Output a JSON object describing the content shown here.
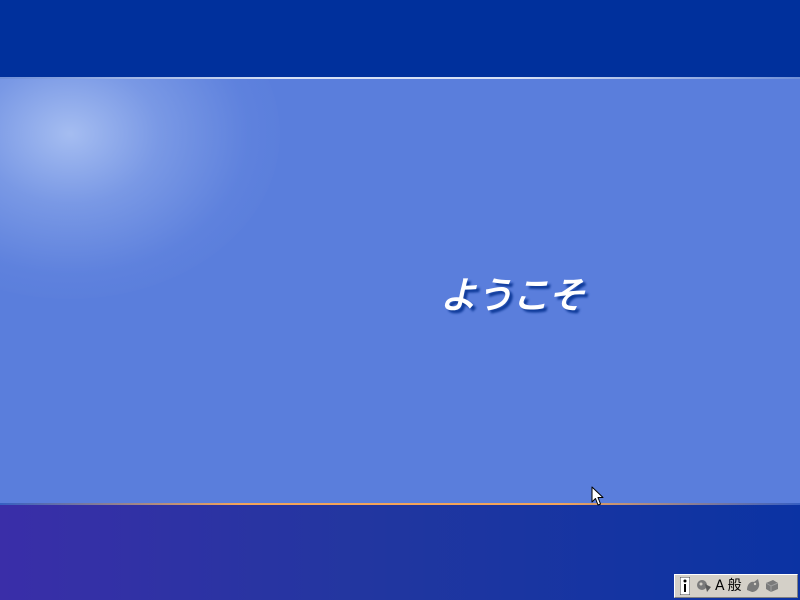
{
  "welcome_screen": {
    "welcome_text": "ようこそ"
  },
  "language_bar": {
    "ime_mode_label": "A",
    "conversion_mode_label": "般",
    "icons": [
      "ime-info-icon",
      "ime-pad-icon",
      "conversion-mode-icon",
      "input-mode-icon",
      "ime-options-icon",
      "ime-settings-icon"
    ]
  },
  "colors": {
    "top_band": "#00309c",
    "main_area": "#5a7edc",
    "bottom_band_start": "#3a2ea8",
    "bottom_band_end": "#0b33a3",
    "accent_line": "#f2a45a",
    "welcome_text": "#ffffff",
    "welcome_shadow": "#0f3b9a"
  }
}
